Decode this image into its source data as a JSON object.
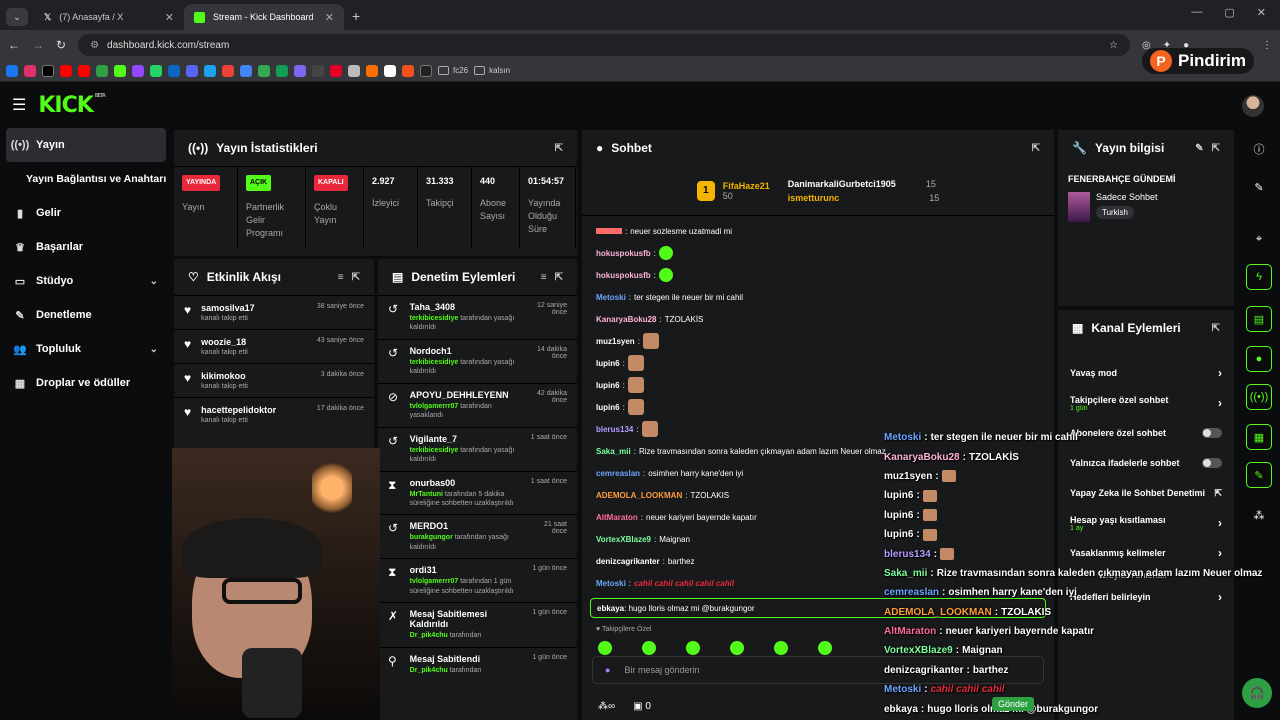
{
  "browser": {
    "tabs": [
      {
        "title": "(7) Anasayfa / X"
      },
      {
        "title": "Stream - Kick Dashboard"
      }
    ],
    "url": "dashboard.kick.com/stream",
    "bookmarks": [
      "fc26",
      "kalsın"
    ]
  },
  "watermark": "Pindirim",
  "sidebar": {
    "items": [
      "Yayın",
      "Yayın Bağlantısı ve Anahtarı",
      "Gelir",
      "Başarılar",
      "Stüdyo",
      "Denetleme",
      "Topluluk",
      "Droplar ve ödüller"
    ]
  },
  "stats": {
    "title": "Yayın İstatistikleri",
    "items": [
      {
        "badge": "YAYINDA",
        "label": "Yayın",
        "color": "#e8283b"
      },
      {
        "badge": "AÇIK",
        "label": "Partnerlik Gelir Programı",
        "color": "#53fc18"
      },
      {
        "badge": "KAPALI",
        "label": "Çoklu Yayın",
        "color": "#e8283b"
      },
      {
        "value": "2.927",
        "label": "İzleyici"
      },
      {
        "value": "31.333",
        "label": "Takipçi"
      },
      {
        "value": "440",
        "label": "Abone Sayısı"
      },
      {
        "value": "01:54:57",
        "label": "Yayında Olduğu Süre"
      }
    ]
  },
  "activity": {
    "title": "Etkinlik Akışı",
    "rows": [
      {
        "name": "samosilva17",
        "sub": "kanalı takip etti",
        "time": "38 saniye önce"
      },
      {
        "name": "woozie_18",
        "sub": "kanalı takip etti",
        "time": "43 saniye önce"
      },
      {
        "name": "kikimokoo",
        "sub": "kanalı takip etti",
        "time": "3 dakika önce"
      },
      {
        "name": "hacettepelidoktor",
        "sub": "kanalı takip etti",
        "time": "17 dakika önce"
      }
    ]
  },
  "moderation": {
    "title": "Denetim Eylemleri",
    "rows": [
      {
        "name": "Taha_3408",
        "mod": "terkibicesidiye",
        "text": "tarafından yasağı kaldırıldı",
        "time": "12 saniye önce",
        "icon": "↺"
      },
      {
        "name": "Nordoch1",
        "mod": "terkibicesidiye",
        "text": "tarafından yasağı kaldırıldı",
        "time": "14 dakika önce",
        "icon": "↺"
      },
      {
        "name": "APOYU_DEHHLEYENN",
        "mod": "tvlolgamerrr07",
        "text": "tarafından yasaklandı",
        "time": "42 dakika önce",
        "icon": "⊘"
      },
      {
        "name": "Vigilante_7",
        "mod": "terkibicesidiye",
        "text": "tarafından yasağı kaldırıldı",
        "time": "1 saat önce",
        "icon": "↺"
      },
      {
        "name": "onurbas00",
        "mod": "MrTantuni",
        "text": "tarafından 5 dakika süreliğine sohbetten uzaklaştırıldı",
        "time": "1 saat önce",
        "icon": "⧗"
      },
      {
        "name": "MERDO1",
        "mod": "burakgungor",
        "text": "tarafından yasağı kaldırıldı",
        "time": "21 saat önce",
        "icon": "↺"
      },
      {
        "name": "ordi31",
        "mod": "tvlolgamerrr07",
        "text": "tarafından 1 gün süreliğine sohbetten uzaklaştırıldı",
        "time": "1 gün önce",
        "icon": "⧗"
      },
      {
        "name": "Mesaj Sabitlemesi Kaldırıldı",
        "mod": "Dr_pik4chu",
        "text": "tarafından",
        "time": "1 gün önce",
        "icon": "✗"
      },
      {
        "name": "Mesaj Sabitlendi",
        "mod": "Dr_pik4chu",
        "text": "tarafından",
        "time": "1 gün önce",
        "icon": "⚲"
      }
    ]
  },
  "chat": {
    "title": "Sohbet",
    "top": [
      {
        "name": "FifaHaze21",
        "count": "50",
        "rank": "1"
      },
      {
        "name": "DanimarkaliGurbetci1905",
        "count": "15"
      },
      {
        "name": "ismetturunc",
        "count": "15"
      }
    ],
    "lines": [
      {
        "user": "",
        "color": "#ff6b6b",
        "msg": "neuer sozlesme uzatmadi mi"
      },
      {
        "user": "hokuspokusfb",
        "color": "#ffb3d9",
        "msg": "",
        "emote": "green"
      },
      {
        "user": "hokuspokusfb",
        "color": "#ffb3d9",
        "msg": "",
        "emote": "green"
      },
      {
        "user": "Metoski",
        "color": "#6aa5ff",
        "msg": "ter stegen ile neuer bir mi cahil"
      },
      {
        "user": "KanaryaBoku28",
        "color": "#ffb3d9",
        "msg": "TZOLAKİS"
      },
      {
        "user": "muz1syen",
        "color": "#ffffff",
        "msg": "",
        "emote": "face"
      },
      {
        "user": "lupin6",
        "color": "#ffffff",
        "msg": "",
        "emote": "face"
      },
      {
        "user": "lupin6",
        "color": "#ffffff",
        "msg": "",
        "emote": "face"
      },
      {
        "user": "lupin6",
        "color": "#ffffff",
        "msg": "",
        "emote": "face"
      },
      {
        "user": "blerus134",
        "color": "#b79cff",
        "msg": "",
        "emote": "face"
      },
      {
        "user": "Saka_mii",
        "color": "#7dff9c",
        "msg": "Rize travmasından sonra kaleden çıkmayan adam lazım Neuer olmaz"
      },
      {
        "user": "cemreaslan",
        "color": "#6aa5ff",
        "msg": "osimhen harry kane'den iyi"
      },
      {
        "user": "ADEMOLA_LOOKMAN",
        "color": "#ff9d3a",
        "msg": "TZOLAKIS"
      },
      {
        "user": "AltMaraton",
        "color": "#ff6b9b",
        "msg": "neuer kariyeri bayernde kapatır"
      },
      {
        "user": "VortexXBlaze9",
        "color": "#7dff9c",
        "msg": "Maignan"
      },
      {
        "user": "denizcagrikanter",
        "color": "#ffffff",
        "msg": "barthez"
      },
      {
        "user": "Metoski",
        "color": "#6aa5ff",
        "msg": "",
        "red": "cahil cahil cahil cahil cahil"
      }
    ],
    "highlight": {
      "user": "ebkaya",
      "msg": "hugo lloris olmaz mi @burakgungor"
    },
    "follow_only": "Takipçilere Özel",
    "placeholder": "Bir mesaj gönderin",
    "footer_count": "0"
  },
  "info": {
    "title": "Yayın bilgisi",
    "heading": "FENERBAHÇE GÜNDEMİ",
    "category": "Sadece Sohbet",
    "tag": "Turkish"
  },
  "channel_actions": {
    "title": "Kanal Eylemleri",
    "items": [
      {
        "label": "Yavaş mod",
        "type": "arrow"
      },
      {
        "label": "Takipçilere özel sohbet",
        "sub": "1 gün",
        "type": "arrow"
      },
      {
        "label": "Abonelere özel sohbet",
        "type": "toggle"
      },
      {
        "label": "Yalnızca ifadelerle sohbet",
        "type": "toggle"
      },
      {
        "label": "Yapay Zeka ile Sohbet Denetimi",
        "type": "ext"
      },
      {
        "label": "Hesap yaşı kısıtlaması",
        "sub": "1 ay",
        "type": "arrow"
      },
      {
        "label": "Yasaklanmış kelimeler",
        "type": "arrow"
      },
      {
        "label": "İzleyici Yönlendir",
        "type": "none"
      },
      {
        "label": "Hedefleri belirleyin",
        "type": "arrow"
      }
    ]
  },
  "overlay": {
    "lines": [
      {
        "user": "Metoski",
        "color": "#6aa5ff",
        "msg": "ter stegen ile neuer bir mi cahil"
      },
      {
        "user": "KanaryaBoku28",
        "color": "#ffb3d9",
        "msg": "TZOLAKİS"
      },
      {
        "user": "muz1syen",
        "color": "#ffffff",
        "msg": "",
        "emote": true
      },
      {
        "user": "lupin6",
        "color": "#ffffff",
        "msg": "",
        "emote": true
      },
      {
        "user": "lupin6",
        "color": "#ffffff",
        "msg": "",
        "emote": true
      },
      {
        "user": "lupin6",
        "color": "#ffffff",
        "msg": "",
        "emote": true
      },
      {
        "user": "blerus134",
        "color": "#b79cff",
        "msg": "",
        "emote": true
      },
      {
        "user": "Saka_mii",
        "color": "#7dff9c",
        "msg": "Rize travmasından sonra kaleden çıkmayan adam lazım Neuer olmaz"
      },
      {
        "user": "cemreaslan",
        "color": "#6aa5ff",
        "msg": "osimhen harry kane'den iyi"
      },
      {
        "user": "ADEMOLA_LOOKMAN",
        "color": "#ff9d3a",
        "msg": "TZOLAKIS"
      },
      {
        "user": "AltMaraton",
        "color": "#ff6b9b",
        "msg": "neuer kariyeri bayernde kapatır"
      },
      {
        "user": "VortexXBlaze9",
        "color": "#7dff9c",
        "msg": "Maignan"
      },
      {
        "user": "denizcagrikanter",
        "color": "#ffffff",
        "msg": "barthez"
      },
      {
        "user": "Metoski",
        "color": "#6aa5ff",
        "msg": "",
        "red": "cahil cahil cahil"
      },
      {
        "user": "ebkaya",
        "color": "#ffffff",
        "msg": "hugo lloris olmaz mi @burakgungor"
      }
    ],
    "send_label": "Gönder"
  },
  "colors": {
    "accent": "#53fc18",
    "live": "#e8283b",
    "panel": "#18191b"
  }
}
